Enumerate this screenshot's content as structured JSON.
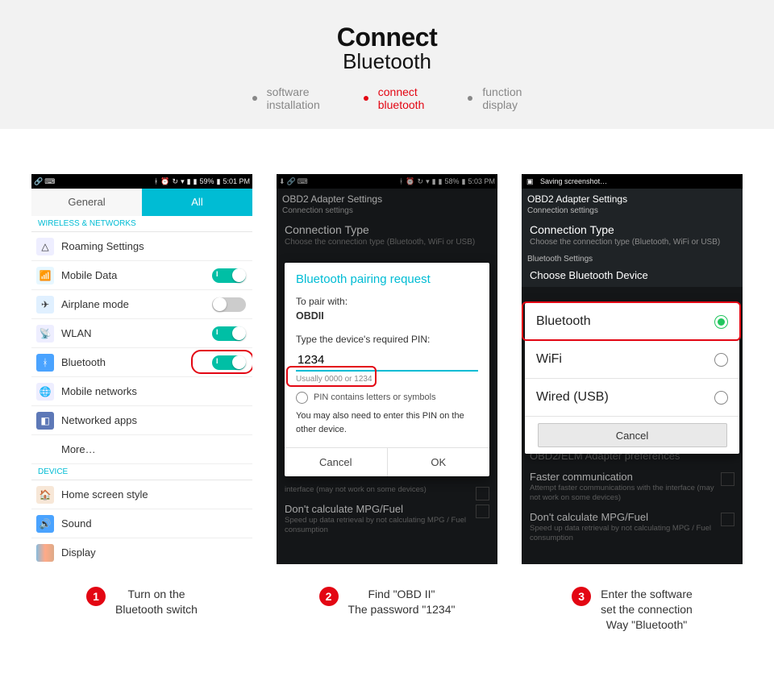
{
  "hero": {
    "title1": "Connect",
    "title2": "Bluetooth",
    "crumbs": [
      {
        "l1": "software",
        "l2": "installation"
      },
      {
        "l1": "connect",
        "l2": "bluetooth"
      },
      {
        "l1": "function",
        "l2": "display"
      }
    ]
  },
  "panel1": {
    "status": {
      "pct": "59%",
      "time": "5:01 PM"
    },
    "tabs": {
      "general": "General",
      "all": "All"
    },
    "sec_wireless": "WIRELESS & NETWORKS",
    "rows": {
      "roaming": "Roaming Settings",
      "mobile_data": "Mobile Data",
      "airplane": "Airplane mode",
      "wlan": "WLAN",
      "bluetooth": "Bluetooth",
      "mobile_net": "Mobile networks",
      "net_apps": "Networked apps",
      "more": "More…"
    },
    "sec_device": "DEVICE",
    "dev": {
      "home": "Home screen style",
      "sound": "Sound",
      "display": "Display"
    }
  },
  "panel2": {
    "status": {
      "pct": "58%",
      "time": "5:03 PM"
    },
    "obd_title": "OBD2 Adapter Settings",
    "obd_sub": "Connection settings",
    "conn_type": {
      "h": "Connection Type",
      "s": "Choose the connection type (Bluetooth, WiFi or USB)"
    },
    "modal": {
      "title": "Bluetooth pairing request",
      "pair_label": "To pair with:",
      "device": "OBDII",
      "pin_label": "Type the device's required PIN:",
      "pin_value": "1234",
      "hint": "Usually 0000 or 1234",
      "chk": "PIN contains letters or symbols",
      "note": "You may also need to enter this PIN on the other device.",
      "cancel": "Cancel",
      "ok": "OK"
    },
    "under1": {
      "s": "interface (may not work on some devices)"
    },
    "under2": {
      "h": "Don't calculate MPG/Fuel",
      "s": "Speed up data retrieval by not calculating MPG / Fuel consumption"
    }
  },
  "panel3": {
    "status": "Saving screenshot…",
    "obd_title": "OBD2 Adapter Settings",
    "obd_sub": "Connection settings",
    "conn_type": {
      "h": "Connection Type",
      "s": "Choose the connection type (Bluetooth, WiFi or USB)"
    },
    "bt_settings": "Bluetooth Settings",
    "choose_bt": "Choose Bluetooth Device",
    "opts": {
      "bt": "Bluetooth",
      "wifi": "WiFi",
      "usb": "Wired (USB)",
      "cancel": "Cancel"
    },
    "under0": {
      "h": "OBD2/ELM Adapter preferences"
    },
    "under1": {
      "h": "Faster communication",
      "s": "Attempt faster communications with the interface (may not work on some devices)"
    },
    "under2": {
      "h": "Don't calculate MPG/Fuel",
      "s": "Speed up data retrieval by not calculating MPG / Fuel consumption"
    }
  },
  "captions": {
    "c1": {
      "num": "1",
      "l1": "Turn on the",
      "l2": "Bluetooth switch"
    },
    "c2": {
      "num": "2",
      "l1": "Find  \"OBD II\"",
      "l2": "The password \"1234\""
    },
    "c3": {
      "num": "3",
      "l1": "Enter the software",
      "l2": "set the connection",
      "l3": "Way \"Bluetooth\""
    }
  }
}
